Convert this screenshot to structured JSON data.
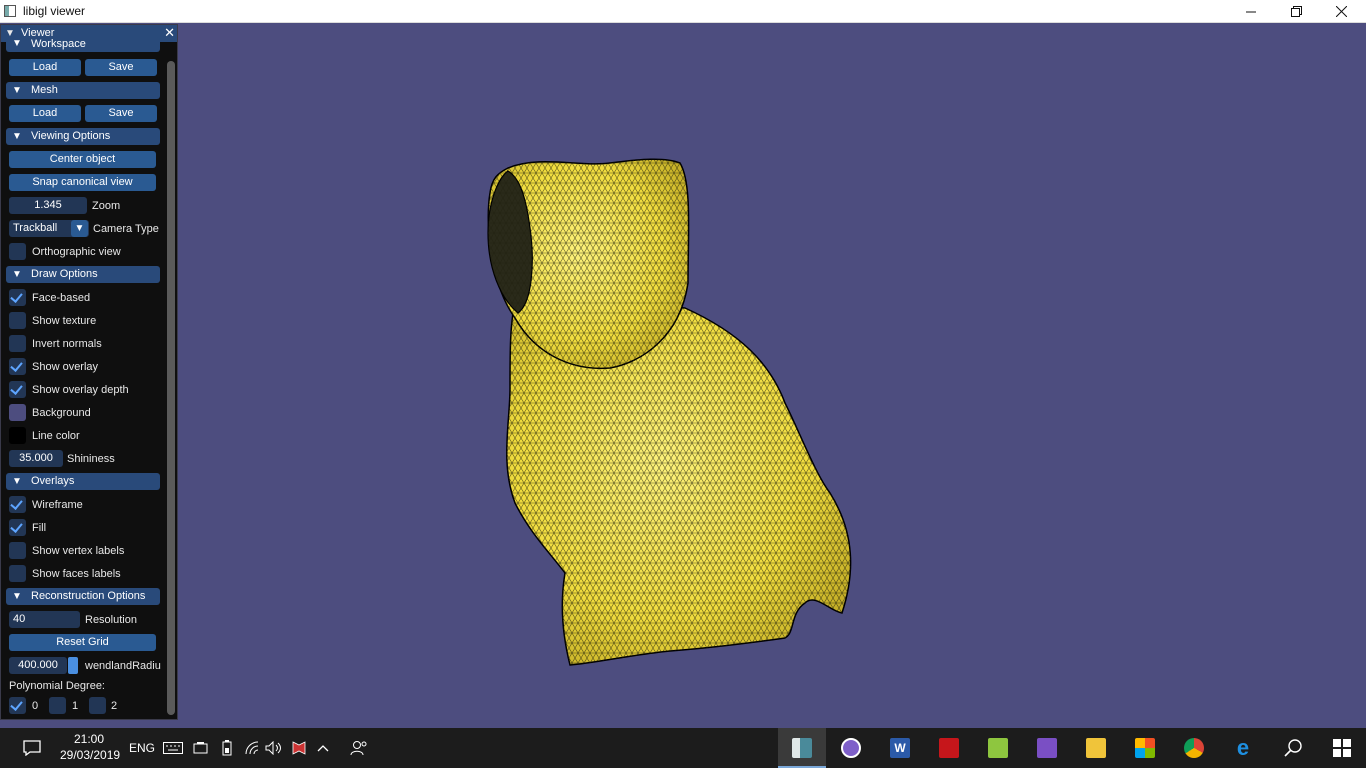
{
  "window": {
    "title": "libigl viewer"
  },
  "panel": {
    "title": "Viewer",
    "workspace": {
      "header": "Workspace",
      "load": "Load",
      "save": "Save"
    },
    "mesh": {
      "header": "Mesh",
      "load": "Load",
      "save": "Save"
    },
    "viewing": {
      "header": "Viewing Options",
      "center": "Center object",
      "snap": "Snap canonical view",
      "zoom_value": "1.345",
      "zoom_label": "Zoom",
      "camera_value": "Trackball",
      "camera_label": "Camera Type",
      "ortho_label": "Orthographic view",
      "ortho_checked": false
    },
    "draw": {
      "header": "Draw Options",
      "face_based": "Face-based",
      "show_texture": "Show texture",
      "invert_normals": "Invert normals",
      "show_overlay": "Show overlay",
      "show_overlay_depth": "Show overlay depth",
      "background": "Background",
      "line_color": "Line color",
      "shininess_value": "35.000",
      "shininess_label": "Shininess"
    },
    "overlays": {
      "header": "Overlays",
      "wireframe": "Wireframe",
      "fill": "Fill",
      "vertex_labels": "Show vertex labels",
      "faces_labels": "Show faces labels"
    },
    "recon": {
      "header": "Reconstruction Options",
      "resolution_value": "40",
      "resolution_label": "Resolution",
      "reset": "Reset Grid",
      "wendland_value": "400.000",
      "wendland_label": "wendlandRadiu",
      "poly_label": "Polynomial Degree:",
      "deg0": "0",
      "deg1": "1",
      "deg2": "2"
    }
  },
  "colors": {
    "viewport_bg": "#4d4d7f",
    "mesh_fill": "#f2e24a",
    "line_color": "#000000",
    "accent": "#294a7a"
  },
  "taskbar": {
    "time": "21:00",
    "date": "29/03/2019",
    "lang": "ENG",
    "apps": [
      "libigl-viewer-icon",
      "discord-icon",
      "word-icon",
      "acrobat-icon",
      "notepad-icon",
      "visual-studio-icon",
      "file-explorer-icon",
      "store-icon",
      "chrome-icon",
      "edge-icon",
      "search-icon",
      "windows-start-icon"
    ]
  }
}
